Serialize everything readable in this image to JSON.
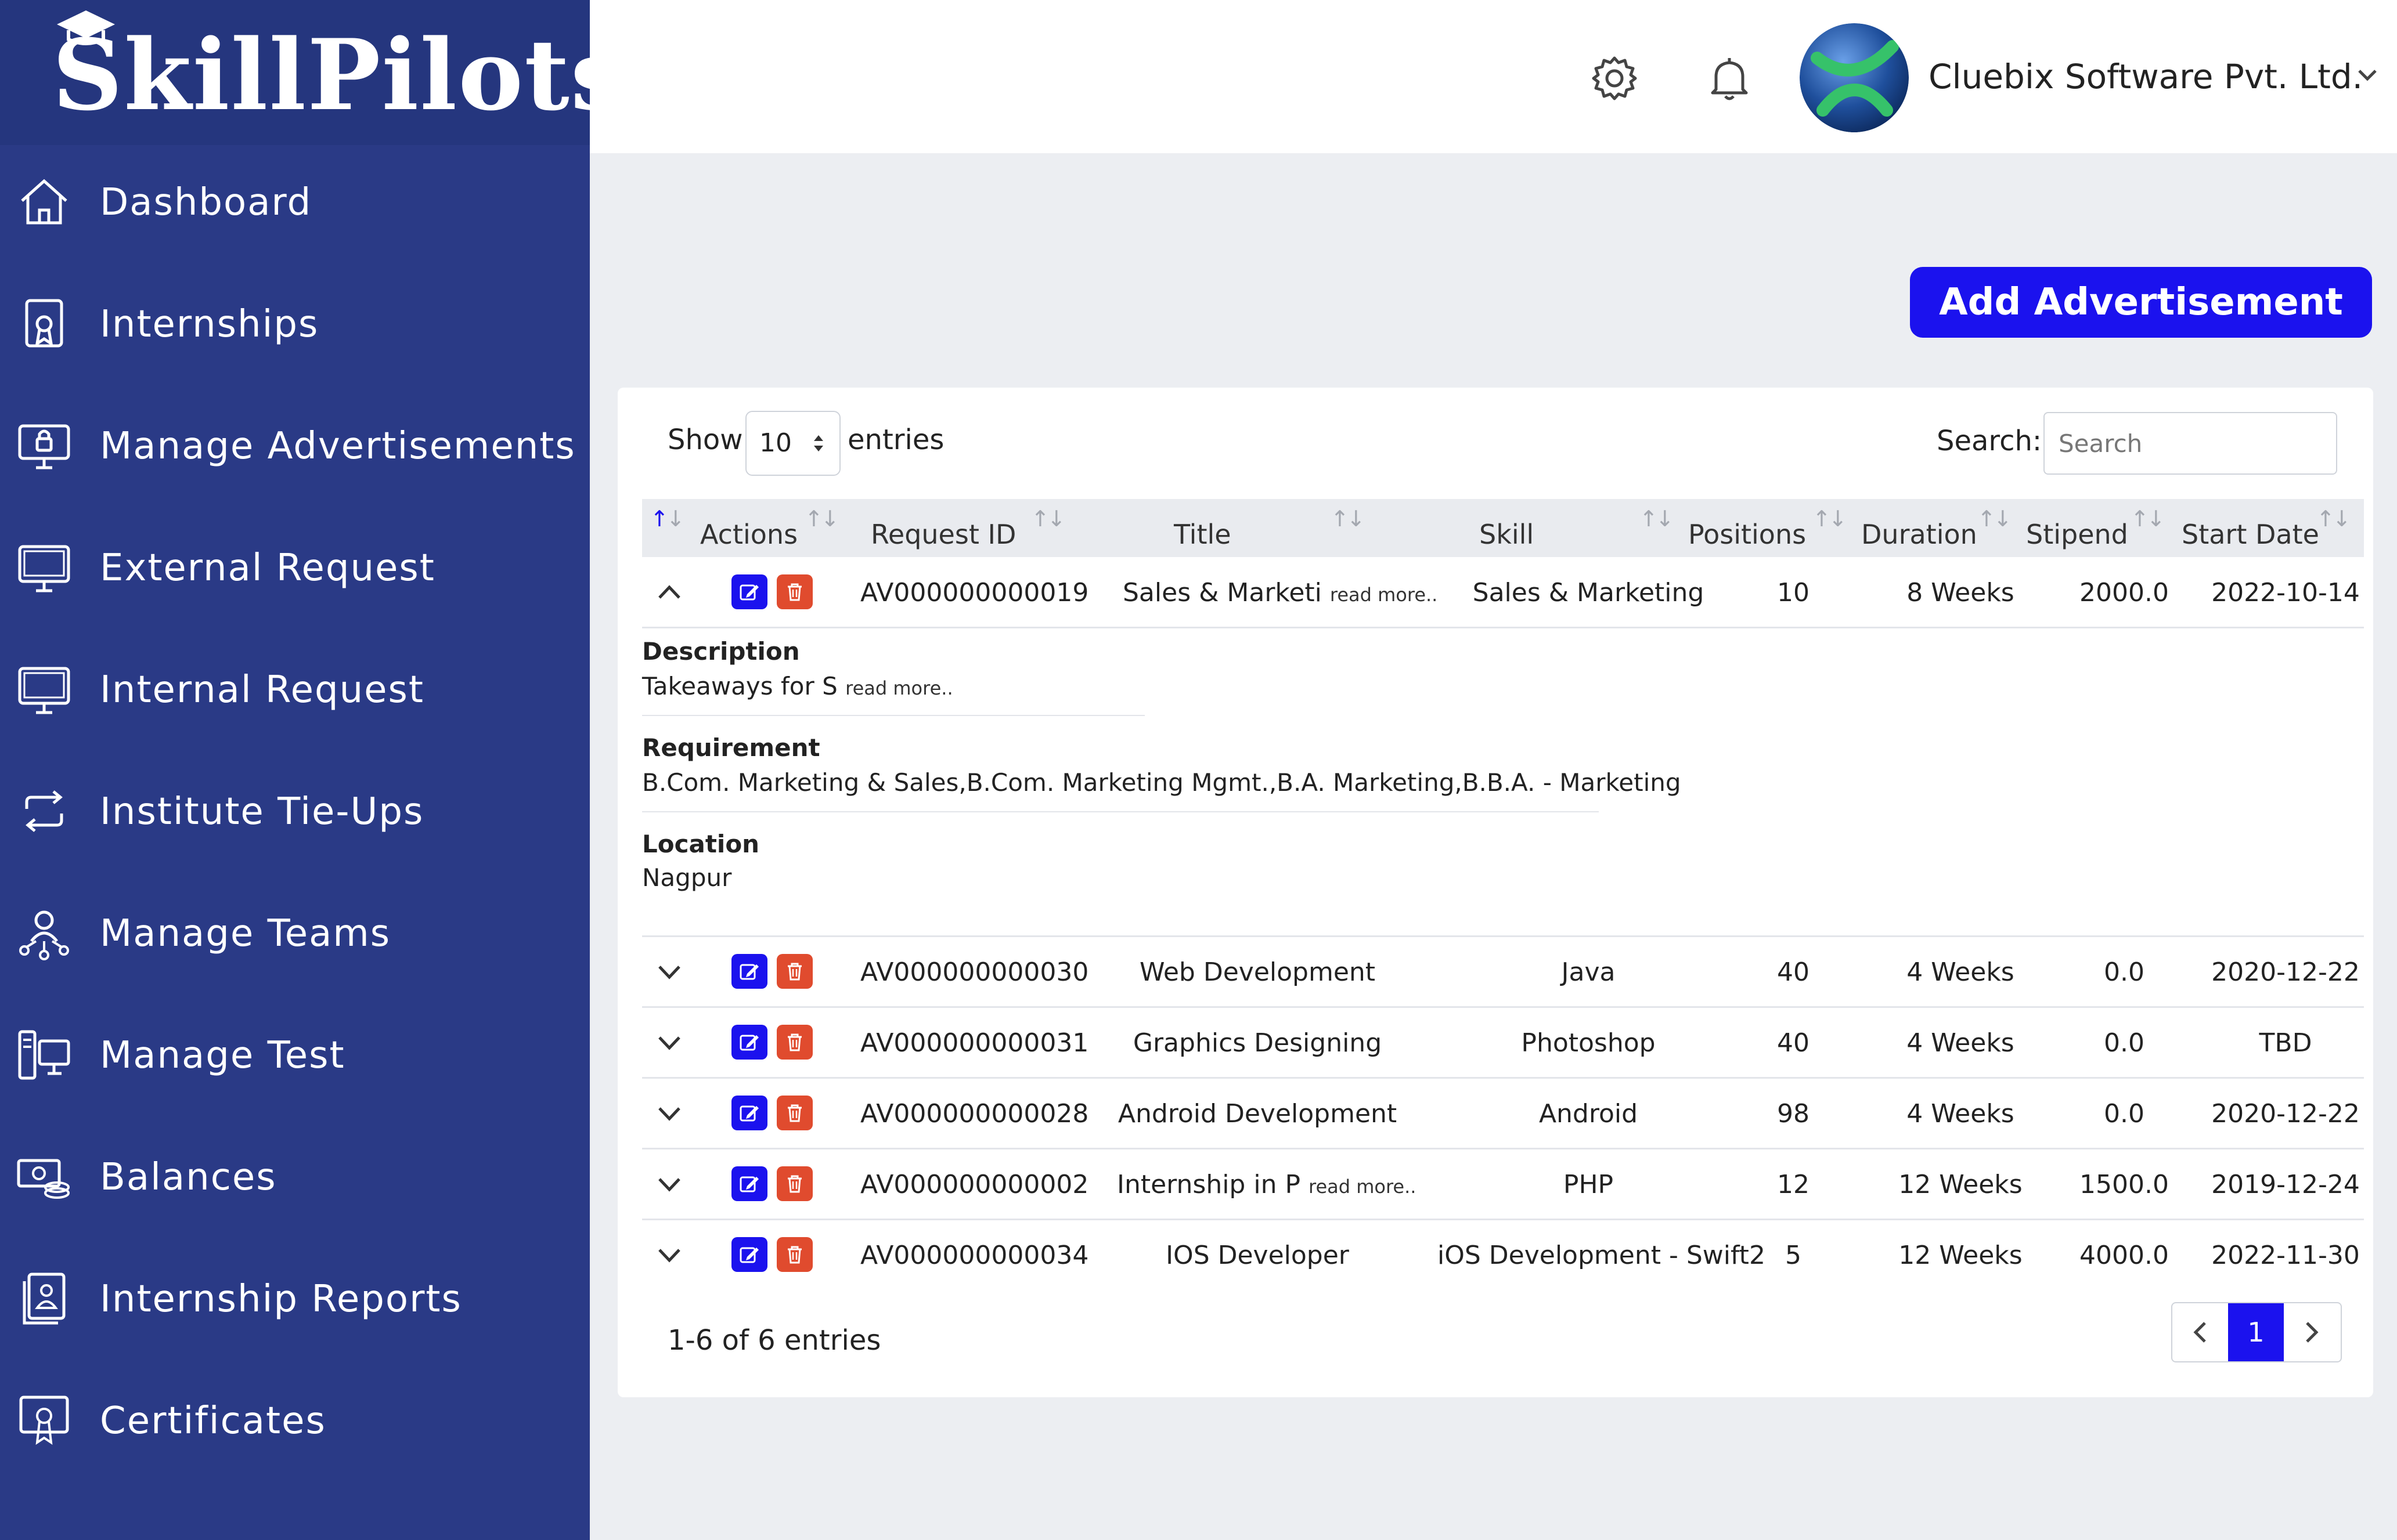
{
  "brand": {
    "name": "SkillPilots"
  },
  "sidebar": {
    "items": [
      {
        "label": "Dashboard",
        "icon": "home-icon"
      },
      {
        "label": "Internships",
        "icon": "document-badge-icon"
      },
      {
        "label": "Manage Advertisements",
        "icon": "monitor-lock-icon"
      },
      {
        "label": "External Request",
        "icon": "monitor-icon"
      },
      {
        "label": "Internal Request",
        "icon": "monitor-icon"
      },
      {
        "label": "Institute Tie-Ups",
        "icon": "sync-icon"
      },
      {
        "label": "Manage Teams",
        "icon": "team-icon"
      },
      {
        "label": "Manage Test",
        "icon": "test-device-icon"
      },
      {
        "label": "Balances",
        "icon": "money-icon"
      },
      {
        "label": "Internship Reports",
        "icon": "report-icon"
      },
      {
        "label": "Certificates",
        "icon": "certificate-icon"
      }
    ]
  },
  "header": {
    "company": "Cluebix Software Pvt. Ltd."
  },
  "actions": {
    "add_label": "Add Advertisement"
  },
  "table_controls": {
    "show_label": "Show",
    "entries_value": "10",
    "entries_label": "entries",
    "search_label": "Search:",
    "search_placeholder": "Search"
  },
  "table": {
    "columns": [
      "Actions",
      "Request ID",
      "Title",
      "Skill",
      "Positions",
      "Duration",
      "Stipend",
      "Start Date"
    ],
    "read_more": "read more..",
    "rows": [
      {
        "id": "AV000000000019",
        "title": "Sales & Marketi",
        "title_truncated": true,
        "skill": "Sales & Marketing",
        "positions": "10",
        "duration": "8 Weeks",
        "stipend": "2000.0",
        "start": "2022-10-14",
        "expanded": true
      },
      {
        "id": "AV000000000030",
        "title": "Web Development",
        "skill": "Java",
        "positions": "40",
        "duration": "4 Weeks",
        "stipend": "0.0",
        "start": "2020-12-22"
      },
      {
        "id": "AV000000000031",
        "title": "Graphics Designing",
        "skill": "Photoshop",
        "positions": "40",
        "duration": "4 Weeks",
        "stipend": "0.0",
        "start": "TBD"
      },
      {
        "id": "AV000000000028",
        "title": "Android Development",
        "skill": "Android",
        "positions": "98",
        "duration": "4 Weeks",
        "stipend": "0.0",
        "start": "2020-12-22"
      },
      {
        "id": "AV000000000002",
        "title": "Internship in P",
        "title_truncated": true,
        "skill": "PHP",
        "positions": "12",
        "duration": "12 Weeks",
        "stipend": "1500.0",
        "start": "2019-12-24"
      },
      {
        "id": "AV000000000034",
        "title": "IOS Developer",
        "skill": "iOS Development - Swift2",
        "positions": "5",
        "duration": "12 Weeks",
        "stipend": "4000.0",
        "start": "2022-11-30"
      }
    ],
    "details": {
      "description_title": "Description",
      "description": "Takeaways for S",
      "requirement_title": "Requirement",
      "requirement": "B.Com. Marketing & Sales,B.Com. Marketing Mgmt.,B.A. Marketing,B.B.A. - Marketing",
      "location_title": "Location",
      "location": "Nagpur"
    }
  },
  "pagination": {
    "info": "1-6 of 6 entries",
    "current": "1"
  },
  "colors": {
    "sidebar": "#2a3a86",
    "accent": "#1b12ee",
    "danger": "#e04b2e"
  }
}
